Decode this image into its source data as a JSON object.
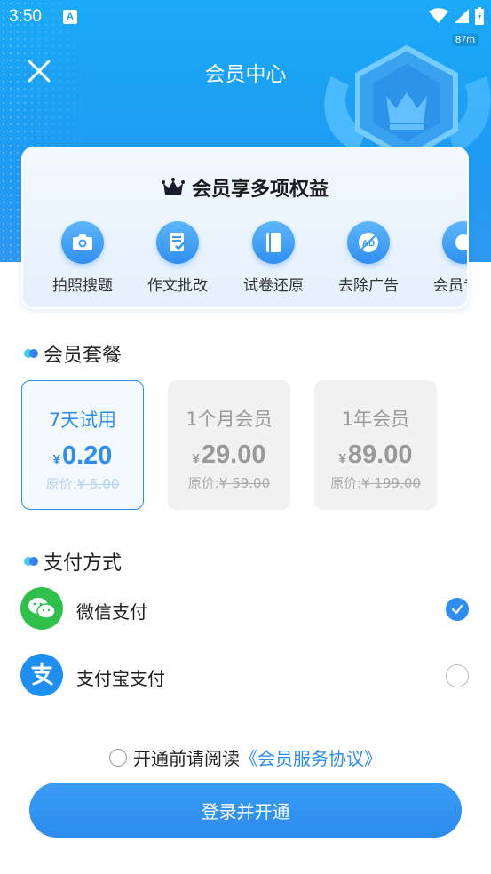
{
  "status_bar": {
    "time": "3:50",
    "notification_letter": "A",
    "speed": "87rh"
  },
  "header": {
    "title": "会员中心"
  },
  "benefits": {
    "title": "会员享多项权益",
    "items": [
      {
        "label": "拍照搜题",
        "icon": "camera-icon"
      },
      {
        "label": "作文批改",
        "icon": "edit-document-icon"
      },
      {
        "label": "试卷还原",
        "icon": "book-icon"
      },
      {
        "label": "去除广告",
        "icon": "no-ads-icon"
      },
      {
        "label": "会员专属",
        "icon": "member-icon"
      }
    ]
  },
  "plans_section": {
    "title": "会员套餐",
    "plans": [
      {
        "name": "7天试用",
        "currency": "¥",
        "price": "0.20",
        "orig_label": "原价:",
        "orig_price": "¥ 5.00",
        "selected": true
      },
      {
        "name": "1个月会员",
        "currency": "¥",
        "price": "29.00",
        "orig_label": "原价:",
        "orig_price": "¥ 59.00",
        "selected": false
      },
      {
        "name": "1年会员",
        "currency": "¥",
        "price": "89.00",
        "orig_label": "原价:",
        "orig_price": "¥ 199.00",
        "selected": false
      }
    ]
  },
  "payment_section": {
    "title": "支付方式",
    "methods": [
      {
        "label": "微信支付",
        "icon": "wechat-pay-icon",
        "color": "#2ec04b",
        "checked": true
      },
      {
        "label": "支付宝支付",
        "icon": "alipay-icon",
        "color": "#1e8ff0",
        "checked": false
      }
    ]
  },
  "agreement": {
    "prefix": "开通前请阅读",
    "link": "《会员服务协议》"
  },
  "login_button": "登录并开通",
  "colors": {
    "accent": "#2f8df0",
    "header": "#1aa9f7",
    "wechat": "#2ec04b"
  }
}
